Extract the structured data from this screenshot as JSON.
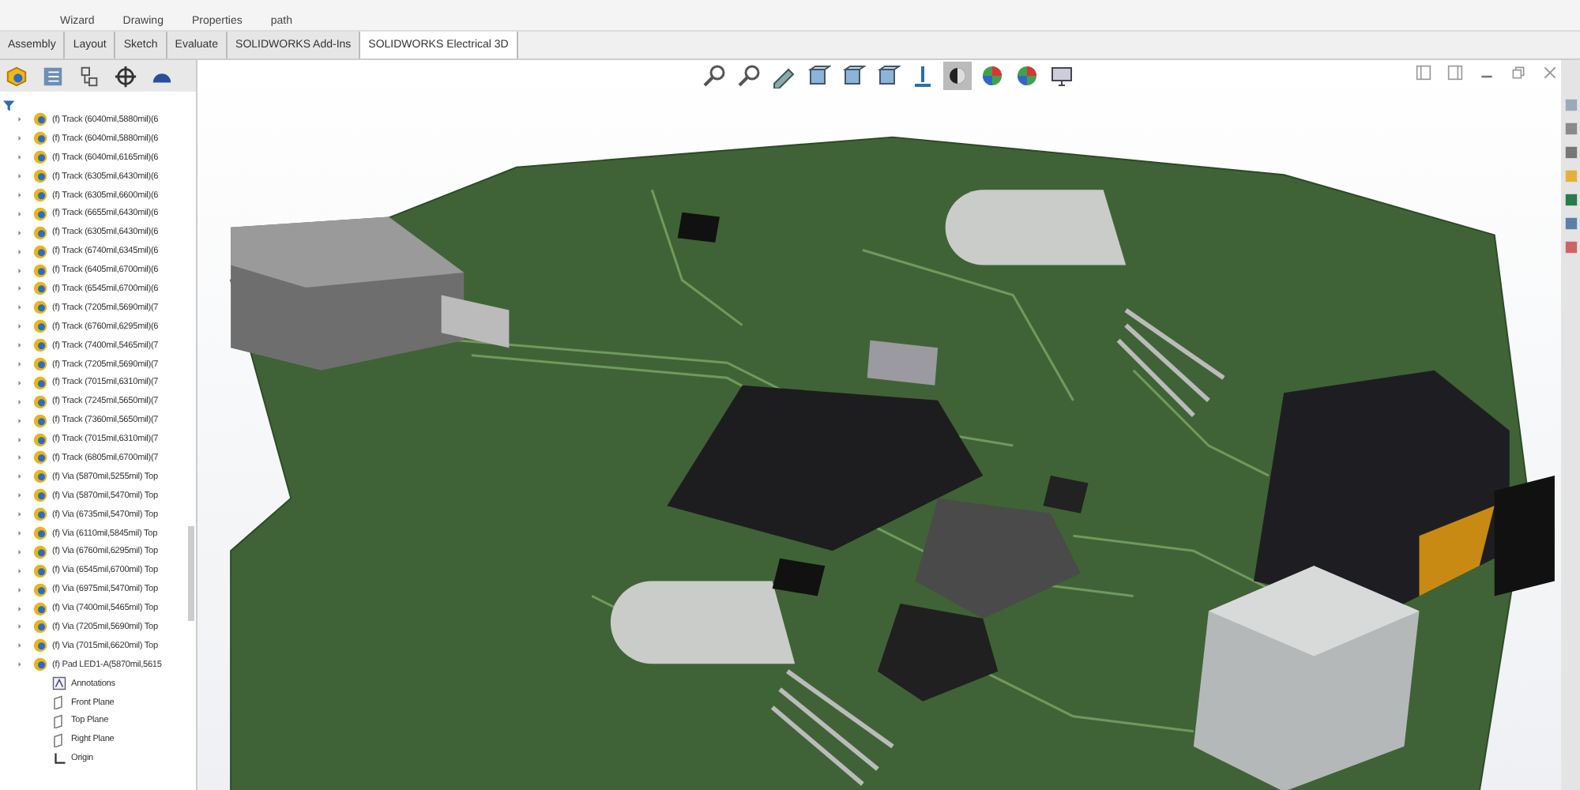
{
  "ribbon": {
    "labels": [
      "Wizard",
      "Drawing",
      "Properties",
      "path"
    ]
  },
  "tabs": [
    {
      "label": "Assembly",
      "selected": false
    },
    {
      "label": "Layout",
      "selected": false
    },
    {
      "label": "Sketch",
      "selected": false
    },
    {
      "label": "Evaluate",
      "selected": false
    },
    {
      "label": "SOLIDWORKS Add-Ins",
      "selected": false
    },
    {
      "label": "SOLIDWORKS Electrical 3D",
      "selected": true
    }
  ],
  "tree": [
    {
      "label": "(f) Track (6040mil,5880mil)(6",
      "kind": "feature"
    },
    {
      "label": "(f) Track (6040mil,5880mil)(6",
      "kind": "feature"
    },
    {
      "label": "(f) Track (6040mil,6165mil)(6",
      "kind": "feature"
    },
    {
      "label": "(f) Track (6305mil,6430mil)(6",
      "kind": "feature"
    },
    {
      "label": "(f) Track (6305mil,6600mil)(6",
      "kind": "feature"
    },
    {
      "label": "(f) Track (6655mil,6430mil)(6",
      "kind": "feature"
    },
    {
      "label": "(f) Track (6305mil,6430mil)(6",
      "kind": "feature"
    },
    {
      "label": "(f) Track (6740mil,6345mil)(6",
      "kind": "feature"
    },
    {
      "label": "(f) Track (6405mil,6700mil)(6",
      "kind": "feature"
    },
    {
      "label": "(f) Track (6545mil,6700mil)(6",
      "kind": "feature"
    },
    {
      "label": "(f) Track (7205mil,5690mil)(7",
      "kind": "feature"
    },
    {
      "label": "(f) Track (6760mil,6295mil)(6",
      "kind": "feature"
    },
    {
      "label": "(f) Track (7400mil,5465mil)(7",
      "kind": "feature"
    },
    {
      "label": "(f) Track (7205mil,5690mil)(7",
      "kind": "feature"
    },
    {
      "label": "(f) Track (7015mil,6310mil)(7",
      "kind": "feature"
    },
    {
      "label": "(f) Track (7245mil,5650mil)(7",
      "kind": "feature"
    },
    {
      "label": "(f) Track (7360mil,5650mil)(7",
      "kind": "feature"
    },
    {
      "label": "(f) Track (7015mil,6310mil)(7",
      "kind": "feature"
    },
    {
      "label": "(f) Track (6805mil,6700mil)(7",
      "kind": "feature"
    },
    {
      "label": "(f) Via (5870mil,5255mil) Top",
      "kind": "feature"
    },
    {
      "label": "(f) Via (5870mil,5470mil) Top",
      "kind": "feature"
    },
    {
      "label": "(f) Via (6735mil,5470mil) Top",
      "kind": "feature"
    },
    {
      "label": "(f) Via (6110mil,5845mil) Top",
      "kind": "feature"
    },
    {
      "label": "(f) Via (6760mil,6295mil) Top",
      "kind": "feature"
    },
    {
      "label": "(f) Via (6545mil,6700mil) Top",
      "kind": "feature"
    },
    {
      "label": "(f) Via (6975mil,5470mil) Top",
      "kind": "feature"
    },
    {
      "label": "(f) Via (7400mil,5465mil) Top",
      "kind": "feature"
    },
    {
      "label": "(f) Via (7205mil,5690mil) Top",
      "kind": "feature"
    },
    {
      "label": "(f) Via (7015mil,6620mil) Top",
      "kind": "feature"
    },
    {
      "label": "(f) Pad LED1-A(5870mil,5615",
      "kind": "feature"
    },
    {
      "label": "Annotations",
      "kind": "annotations"
    },
    {
      "label": "Front Plane",
      "kind": "plane"
    },
    {
      "label": "Top Plane",
      "kind": "plane"
    },
    {
      "label": "Right Plane",
      "kind": "plane"
    },
    {
      "label": "Origin",
      "kind": "origin"
    }
  ]
}
